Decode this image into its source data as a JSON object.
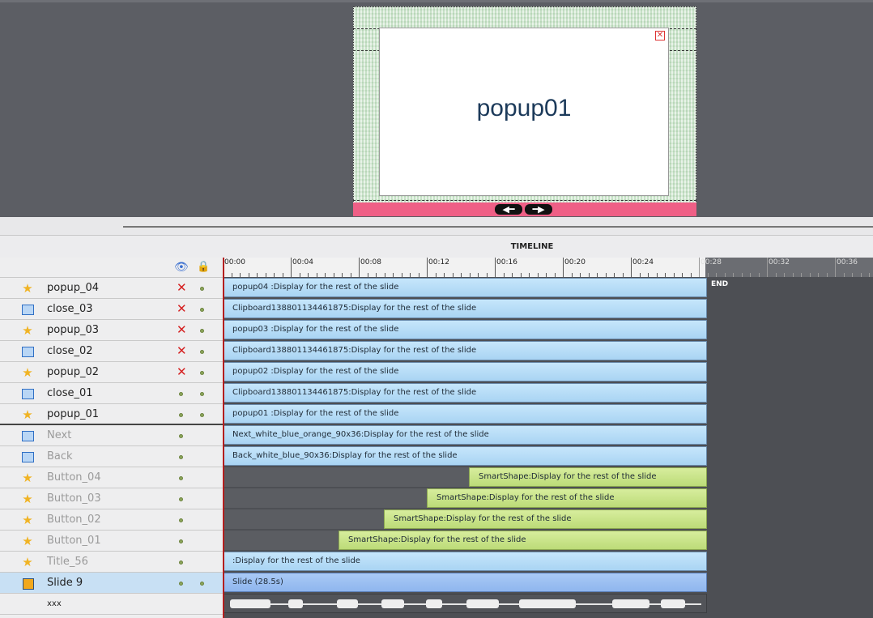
{
  "stage": {
    "popup_title": "popup01",
    "nav_prev_glyph": "◀━",
    "nav_next_glyph": "━▶"
  },
  "timeline": {
    "title": "TIMELINE",
    "end_label": "END",
    "ruler_ticks": [
      "00:00",
      "00:04",
      "00:08",
      "00:12",
      "00:16",
      "00:20",
      "00:24",
      "00:28",
      "00:32",
      "00:36"
    ],
    "header_icons": {
      "visibility": "eye-icon",
      "lock": "lock-icon"
    }
  },
  "layers": [
    {
      "name": "popup_04",
      "icon": "star",
      "visible": false,
      "lock": true,
      "dim": false,
      "bar": {
        "text": "popup04 :Display for the rest of the slide",
        "type": "blue",
        "start": 0,
        "end": 28.5
      }
    },
    {
      "name": "close_03",
      "icon": "image",
      "visible": false,
      "lock": true,
      "dim": false,
      "bar": {
        "text": "Clipboard138801134461875:Display for the rest of the slide",
        "type": "blue",
        "start": 0,
        "end": 28.5
      }
    },
    {
      "name": "popup_03",
      "icon": "star",
      "visible": false,
      "lock": true,
      "dim": false,
      "bar": {
        "text": "popup03 :Display for the rest of the slide",
        "type": "blue",
        "start": 0,
        "end": 28.5
      }
    },
    {
      "name": "close_02",
      "icon": "image",
      "visible": false,
      "lock": true,
      "dim": false,
      "bar": {
        "text": "Clipboard138801134461875:Display for the rest of the slide",
        "type": "blue",
        "start": 0,
        "end": 28.5
      }
    },
    {
      "name": "popup_02",
      "icon": "star",
      "visible": false,
      "lock": true,
      "dim": false,
      "bar": {
        "text": "popup02 :Display for the rest of the slide",
        "type": "blue",
        "start": 0,
        "end": 28.5
      }
    },
    {
      "name": "close_01",
      "icon": "image",
      "visible": true,
      "lock": true,
      "dim": false,
      "bar": {
        "text": "Clipboard138801134461875:Display for the rest of the slide",
        "type": "blue",
        "start": 0,
        "end": 28.5
      }
    },
    {
      "name": "popup_01",
      "icon": "star",
      "visible": true,
      "lock": true,
      "dim": false,
      "bar": {
        "text": "popup01 :Display for the rest of the slide",
        "type": "blue",
        "start": 0,
        "end": 28.5
      }
    },
    {
      "name": "Next",
      "icon": "image",
      "visible": true,
      "lock": false,
      "dim": true,
      "bar": {
        "text": "Next_white_blue_orange_90x36:Display for the rest of the slide",
        "type": "blue",
        "start": 0,
        "end": 28.5
      }
    },
    {
      "name": "Back",
      "icon": "image",
      "visible": true,
      "lock": false,
      "dim": true,
      "bar": {
        "text": "Back_white_blue_90x36:Display for the rest of the slide",
        "type": "blue",
        "start": 0,
        "end": 28.5
      }
    },
    {
      "name": "Button_04",
      "icon": "star",
      "visible": true,
      "lock": false,
      "dim": true,
      "bar": {
        "text": "SmartShape:Display for the rest of the slide",
        "type": "green",
        "start": 14.5,
        "end": 28.5
      }
    },
    {
      "name": "Button_03",
      "icon": "star",
      "visible": true,
      "lock": false,
      "dim": true,
      "bar": {
        "text": "SmartShape:Display for the rest of the slide",
        "type": "green",
        "start": 12,
        "end": 28.5
      }
    },
    {
      "name": "Button_02",
      "icon": "star",
      "visible": true,
      "lock": false,
      "dim": true,
      "bar": {
        "text": "SmartShape:Display for the rest of the slide",
        "type": "green",
        "start": 9.5,
        "end": 28.5
      }
    },
    {
      "name": "Button_01",
      "icon": "star",
      "visible": true,
      "lock": false,
      "dim": true,
      "bar": {
        "text": "SmartShape:Display for the rest of the slide",
        "type": "green",
        "start": 6.8,
        "end": 28.5
      }
    },
    {
      "name": "Title_56",
      "icon": "star",
      "visible": true,
      "lock": false,
      "dim": true,
      "bar": {
        "text": " :Display for the rest of the slide",
        "type": "blue",
        "start": 0,
        "end": 28.5
      }
    },
    {
      "name": "Slide 9",
      "icon": "slide",
      "visible": true,
      "lock": true,
      "dim": false,
      "selected": true,
      "bar": {
        "text": "Slide (28.5s)",
        "type": "slide",
        "start": 0,
        "end": 28.5
      }
    },
    {
      "name": "xxx",
      "icon": "none",
      "visible": null,
      "lock": false,
      "dim": false,
      "small": true,
      "bar": {
        "text": "",
        "type": "audio",
        "start": 0,
        "end": 28.5
      }
    }
  ]
}
